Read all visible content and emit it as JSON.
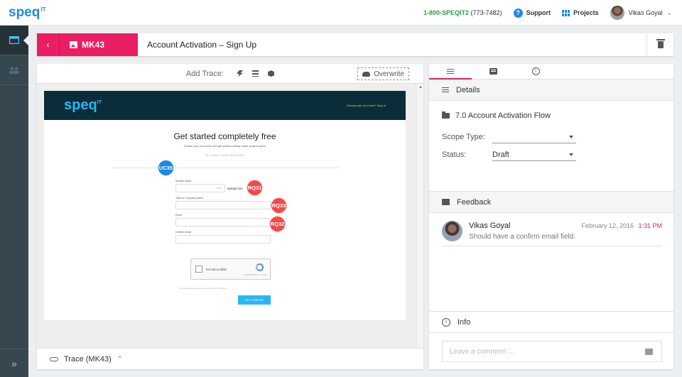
{
  "topbar": {
    "logo": "speq",
    "logo_sup": "IT",
    "phone_label": "1-800-SPEQIT2",
    "phone_number": "(773-7482)",
    "support_label": "Support",
    "projects_label": "Projects",
    "user_name": "Vikas Goyal"
  },
  "header": {
    "tag": "MK43",
    "title": "Account Activation – Sign Up"
  },
  "trace_bar": {
    "label": "Add Trace:",
    "overwrite_label": "Overwrite"
  },
  "mockup": {
    "logo": "speq",
    "logo_sup": "IT",
    "signin": "Already part of a team? Sign in",
    "title": "Get started completely free",
    "subtitle": "Create your own team and get started writing better project specs",
    "no_cc": "NO CREDIT CARD REQUIRED",
    "fields": {
      "domain_label": "Domain Name",
      "domain_placeholder": "team",
      "domain_suffix": "speqit.com",
      "team_label": "Team or Company Name",
      "email_label": "Email",
      "confirm_label": "Confirm Email"
    },
    "captcha_text": "I'm not a robot",
    "captcha_small": "reCAPTCHA Privacy - Terms",
    "terms": "By creating an account you agree to our Terms & Conditions",
    "button": "GET STARTED",
    "badges": {
      "uc": "UC35",
      "rq31": "RQ31",
      "rq33": "RQ33",
      "rq32": "RQ32"
    }
  },
  "trace_footer": {
    "label": "Trace (MK43)"
  },
  "details": {
    "heading": "Details",
    "folder": "7.0 Account Activation Flow",
    "scope_label": "Scope Type:",
    "scope_value": "",
    "status_label": "Status:",
    "status_value": "Draft"
  },
  "feedback": {
    "heading": "Feedback",
    "comments": [
      {
        "author": "Vikas Goyal",
        "text": "Should have a confirm email field.",
        "date": "February 12, 2016",
        "time": "1:31 PM"
      }
    ]
  },
  "info": {
    "heading": "Info",
    "comment_placeholder": "Leave a comment ..."
  },
  "colors": {
    "accent": "#e91e63",
    "brand": "#1e88e5",
    "badge_red": "#f04a4a",
    "rail": "#37474f"
  }
}
